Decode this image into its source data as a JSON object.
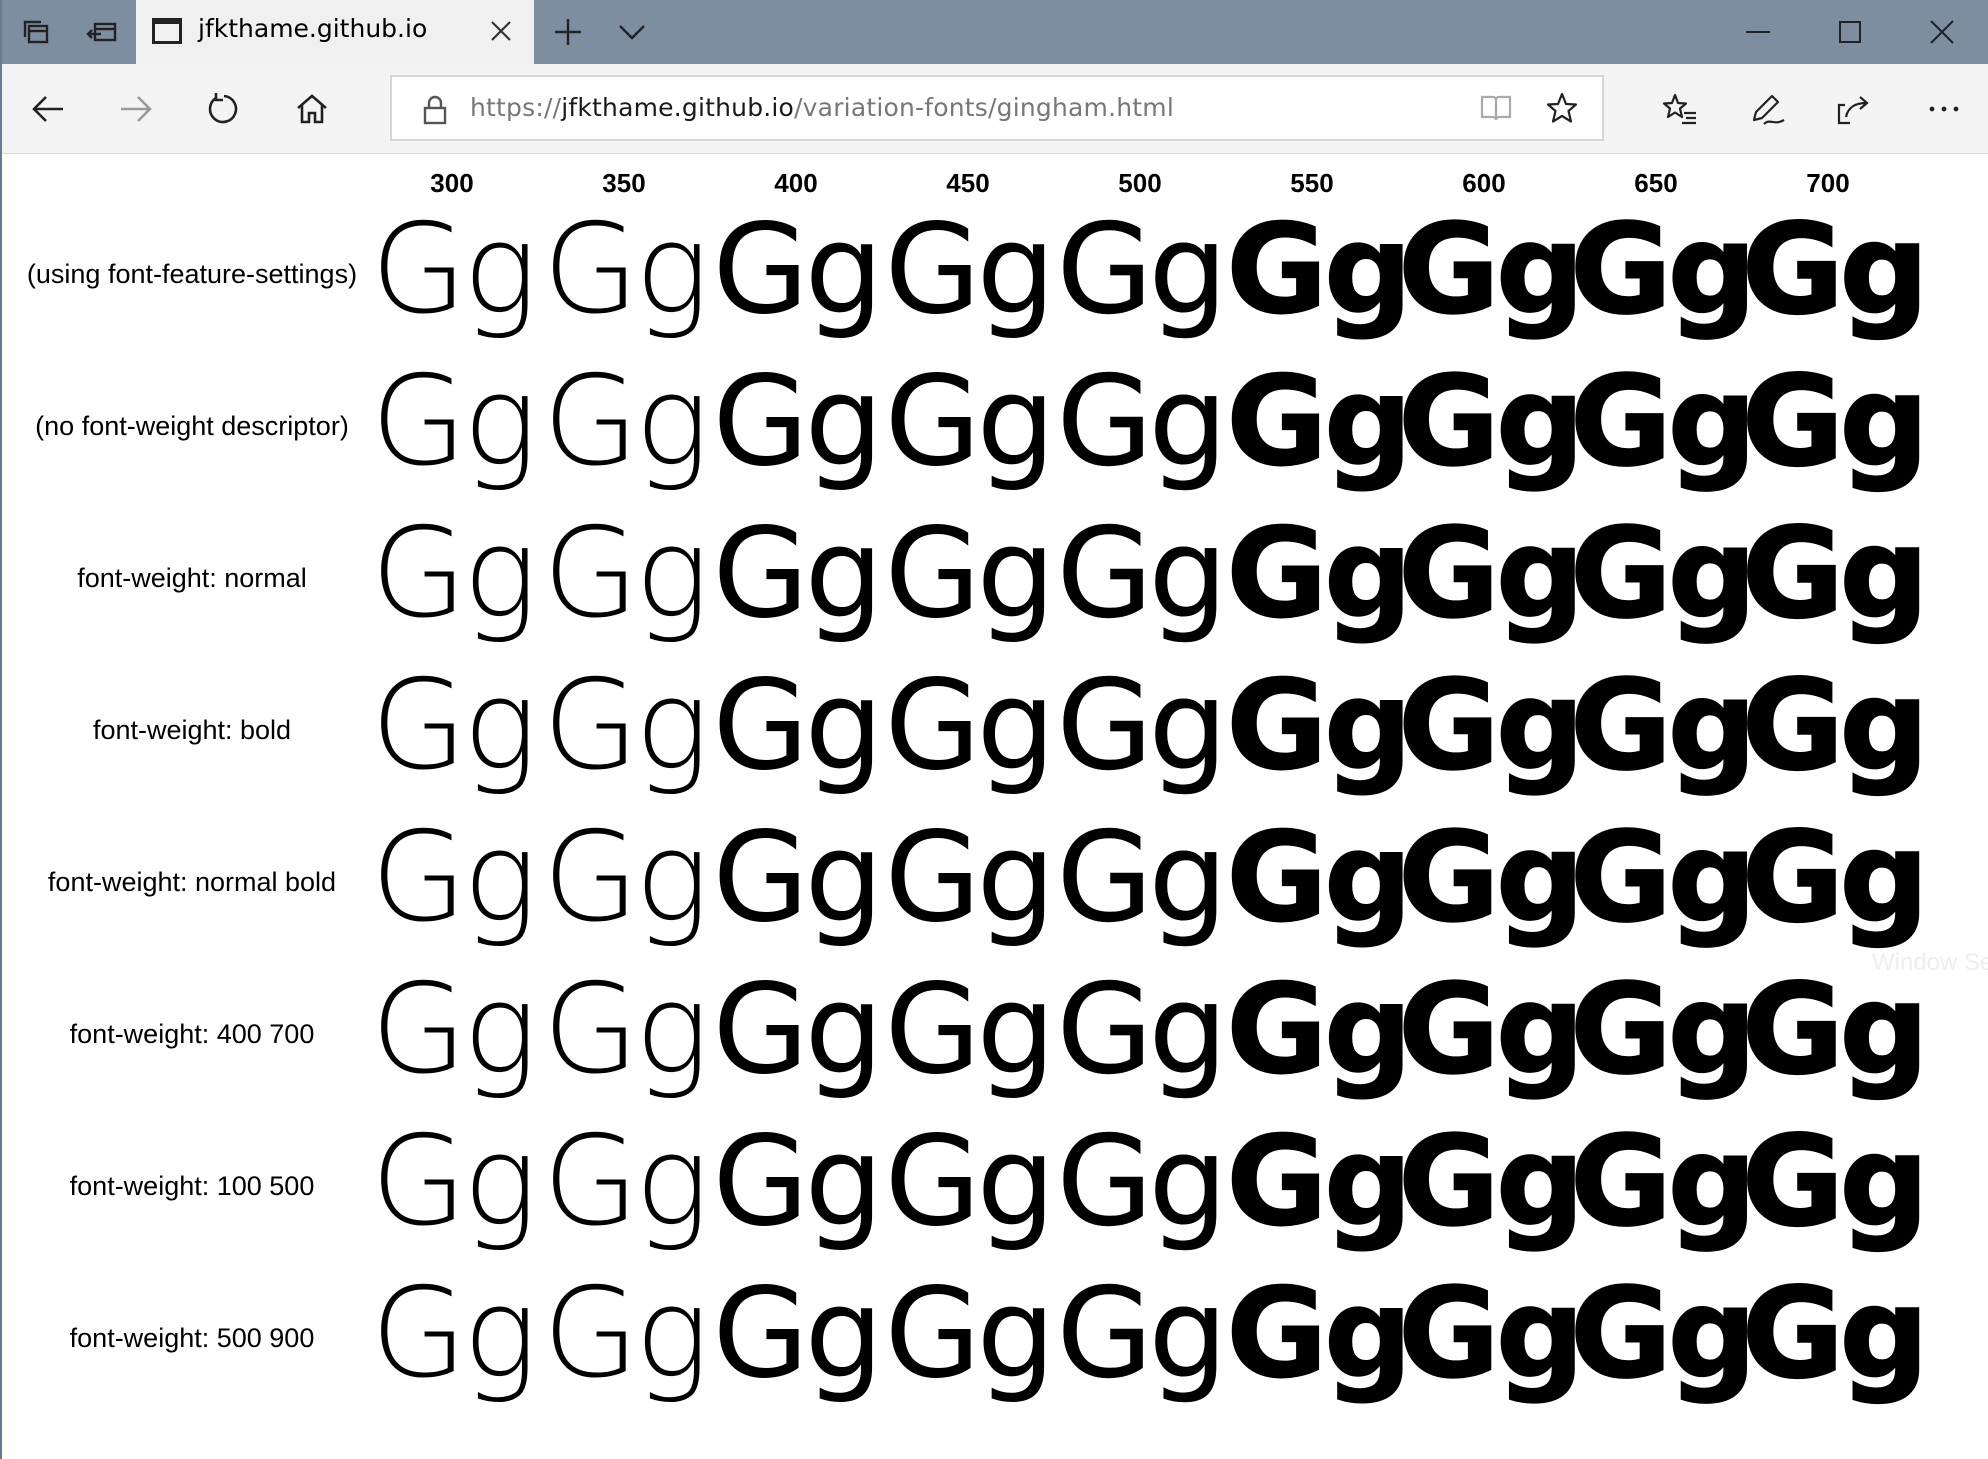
{
  "browser": {
    "tab_title": "jfkthame.github.io",
    "url_scheme": "https://",
    "url_host": "jfkthame.github.io",
    "url_path": "/variation-fonts/gingham.html",
    "icons": [
      "tab-set-aside-icon",
      "tab-restore-icon",
      "page-icon",
      "close-icon",
      "new-tab-icon",
      "chevron-down-icon",
      "minimize-icon",
      "maximize-icon",
      "window-close-icon",
      "back-icon",
      "forward-icon",
      "refresh-icon",
      "home-icon",
      "lock-icon",
      "reading-view-icon",
      "favorite-star-icon",
      "favorites-hub-icon",
      "pen-icon",
      "share-icon",
      "more-icon"
    ]
  },
  "page": {
    "sample_text": "Gg",
    "weights": [
      "300",
      "350",
      "400",
      "450",
      "500",
      "550",
      "600",
      "650",
      "700"
    ],
    "rows": [
      "(using font-feature-settings)",
      "(no font-weight descriptor)",
      "font-weight: normal",
      "font-weight: bold",
      "font-weight: normal bold",
      "font-weight: 400 700",
      "font-weight: 100 500",
      "font-weight: 500 900"
    ],
    "overlay_text": "Window Se"
  }
}
